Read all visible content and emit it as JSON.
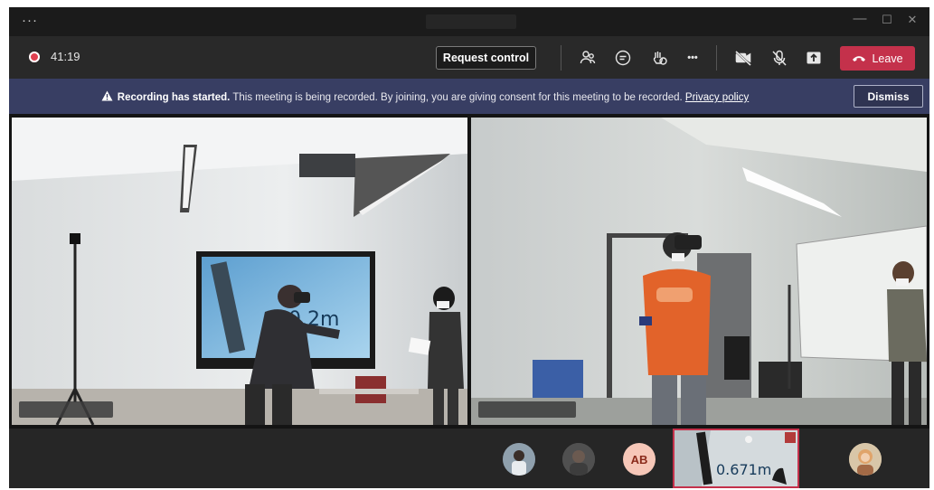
{
  "titlebar": {
    "more_label": "···",
    "minimize": "—",
    "maximize": "☐",
    "close": "✕"
  },
  "toolbar": {
    "timer": "41:19",
    "request_control_label": "Request control",
    "more_actions": "•••",
    "leave_label": "Leave",
    "leave_color": "#c4314b"
  },
  "banner": {
    "title": "Recording has started.",
    "message": " This meeting is being recorded. By joining, you are giving consent for this meeting to be recorded. ",
    "link": "Privacy policy",
    "dismiss_label": "Dismiss",
    "background": "#383e63"
  },
  "stage": {
    "left_video_text": "0.2m",
    "right_video_text": ""
  },
  "filmstrip": {
    "avatar_initials": "AB",
    "thumb_text": "0.671m"
  }
}
